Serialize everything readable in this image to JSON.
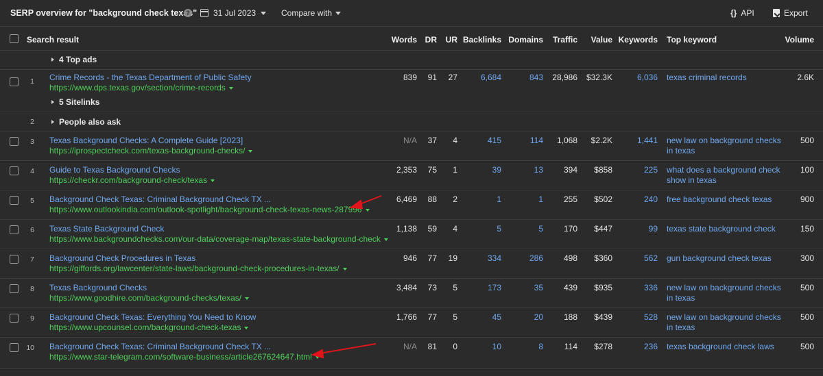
{
  "header": {
    "title": "SERP overview for \"background check texas\"",
    "help_icon": "?",
    "date": "31 Jul 2023",
    "compare": "Compare with",
    "api_glyph": "{}",
    "api": "API",
    "export": "Export"
  },
  "columns": {
    "search_result": "Search result",
    "words": "Words",
    "dr": "DR",
    "ur": "UR",
    "backlinks": "Backlinks",
    "domains": "Domains",
    "traffic": "Traffic",
    "value": "Value",
    "keywords": "Keywords",
    "top_keyword": "Top keyword",
    "volume": "Volume"
  },
  "top_ads": "4 Top ads",
  "sitelinks": "5 Sitelinks",
  "people_also_ask": {
    "pos": "2",
    "label": "People also ask"
  },
  "rows": [
    {
      "pos": "1",
      "title": "Crime Records - the Texas Department of Public Safety",
      "url": "https://www.dps.texas.gov/section/crime-records",
      "words": "839",
      "dr": "91",
      "ur": "27",
      "backlinks": "6,684",
      "domains": "843",
      "traffic": "28,986",
      "value": "$32.3K",
      "keywords": "6,036",
      "kw1": "texas criminal records",
      "kw2": "",
      "volume": "2.6K"
    },
    {
      "pos": "3",
      "title": "Texas Background Checks: A Complete Guide [2023]",
      "url": "https://iprospectcheck.com/texas-background-checks/",
      "words": "N/A",
      "dr": "37",
      "ur": "4",
      "backlinks": "415",
      "domains": "114",
      "traffic": "1,068",
      "value": "$2.2K",
      "keywords": "1,441",
      "kw1": "new law on background checks",
      "kw2": "in texas",
      "volume": "500"
    },
    {
      "pos": "4",
      "title": "Guide to Texas Background Checks",
      "url": "https://checkr.com/background-check/texas",
      "words": "2,353",
      "dr": "75",
      "ur": "1",
      "backlinks": "39",
      "domains": "13",
      "traffic": "394",
      "value": "$858",
      "keywords": "225",
      "kw1": "what does a background check",
      "kw2": "show in texas",
      "volume": "100"
    },
    {
      "pos": "5",
      "title": "Background Check Texas: Criminal Background Check TX ...",
      "url": "https://www.outlookindia.com/outlook-spotlight/background-check-texas-news-287996",
      "words": "6,469",
      "dr": "88",
      "ur": "2",
      "backlinks": "1",
      "domains": "1",
      "traffic": "255",
      "value": "$502",
      "keywords": "240",
      "kw1": "free background check texas",
      "kw2": "",
      "volume": "900"
    },
    {
      "pos": "6",
      "title": "Texas State Background Check",
      "url": "https://www.backgroundchecks.com/our-data/coverage-map/texas-state-background-check",
      "words": "1,138",
      "dr": "59",
      "ur": "4",
      "backlinks": "5",
      "domains": "5",
      "traffic": "170",
      "value": "$447",
      "keywords": "99",
      "kw1": "texas state background check",
      "kw2": "",
      "volume": "150"
    },
    {
      "pos": "7",
      "title": "Background Check Procedures in Texas",
      "url": "https://giffords.org/lawcenter/state-laws/background-check-procedures-in-texas/",
      "words": "946",
      "dr": "77",
      "ur": "19",
      "backlinks": "334",
      "domains": "286",
      "traffic": "498",
      "value": "$360",
      "keywords": "562",
      "kw1": "gun background check texas",
      "kw2": "",
      "volume": "300"
    },
    {
      "pos": "8",
      "title": "Texas Background Checks",
      "url": "https://www.goodhire.com/background-checks/texas/",
      "words": "3,484",
      "dr": "73",
      "ur": "5",
      "backlinks": "173",
      "domains": "35",
      "traffic": "439",
      "value": "$935",
      "keywords": "336",
      "kw1": "new law on background checks",
      "kw2": "in texas",
      "volume": "500"
    },
    {
      "pos": "9",
      "title": "Background Check Texas: Everything You Need to Know",
      "url": "https://www.upcounsel.com/background-check-texas",
      "words": "1,766",
      "dr": "77",
      "ur": "5",
      "backlinks": "45",
      "domains": "20",
      "traffic": "188",
      "value": "$439",
      "keywords": "528",
      "kw1": "new law on background checks",
      "kw2": "in texas",
      "volume": "500"
    },
    {
      "pos": "10",
      "title": "Background Check Texas: Criminal Background Check TX ...",
      "url": "https://www.star-telegram.com/software-business/article267624647.html",
      "words": "N/A",
      "dr": "81",
      "ur": "0",
      "backlinks": "10",
      "domains": "8",
      "traffic": "114",
      "value": "$278",
      "keywords": "236",
      "kw1": "texas background check laws",
      "kw2": "",
      "volume": "500"
    }
  ],
  "colors": {
    "link": "#6fa8f0",
    "url": "#4fcf5a",
    "annotation_arrow": "#e0141a"
  }
}
